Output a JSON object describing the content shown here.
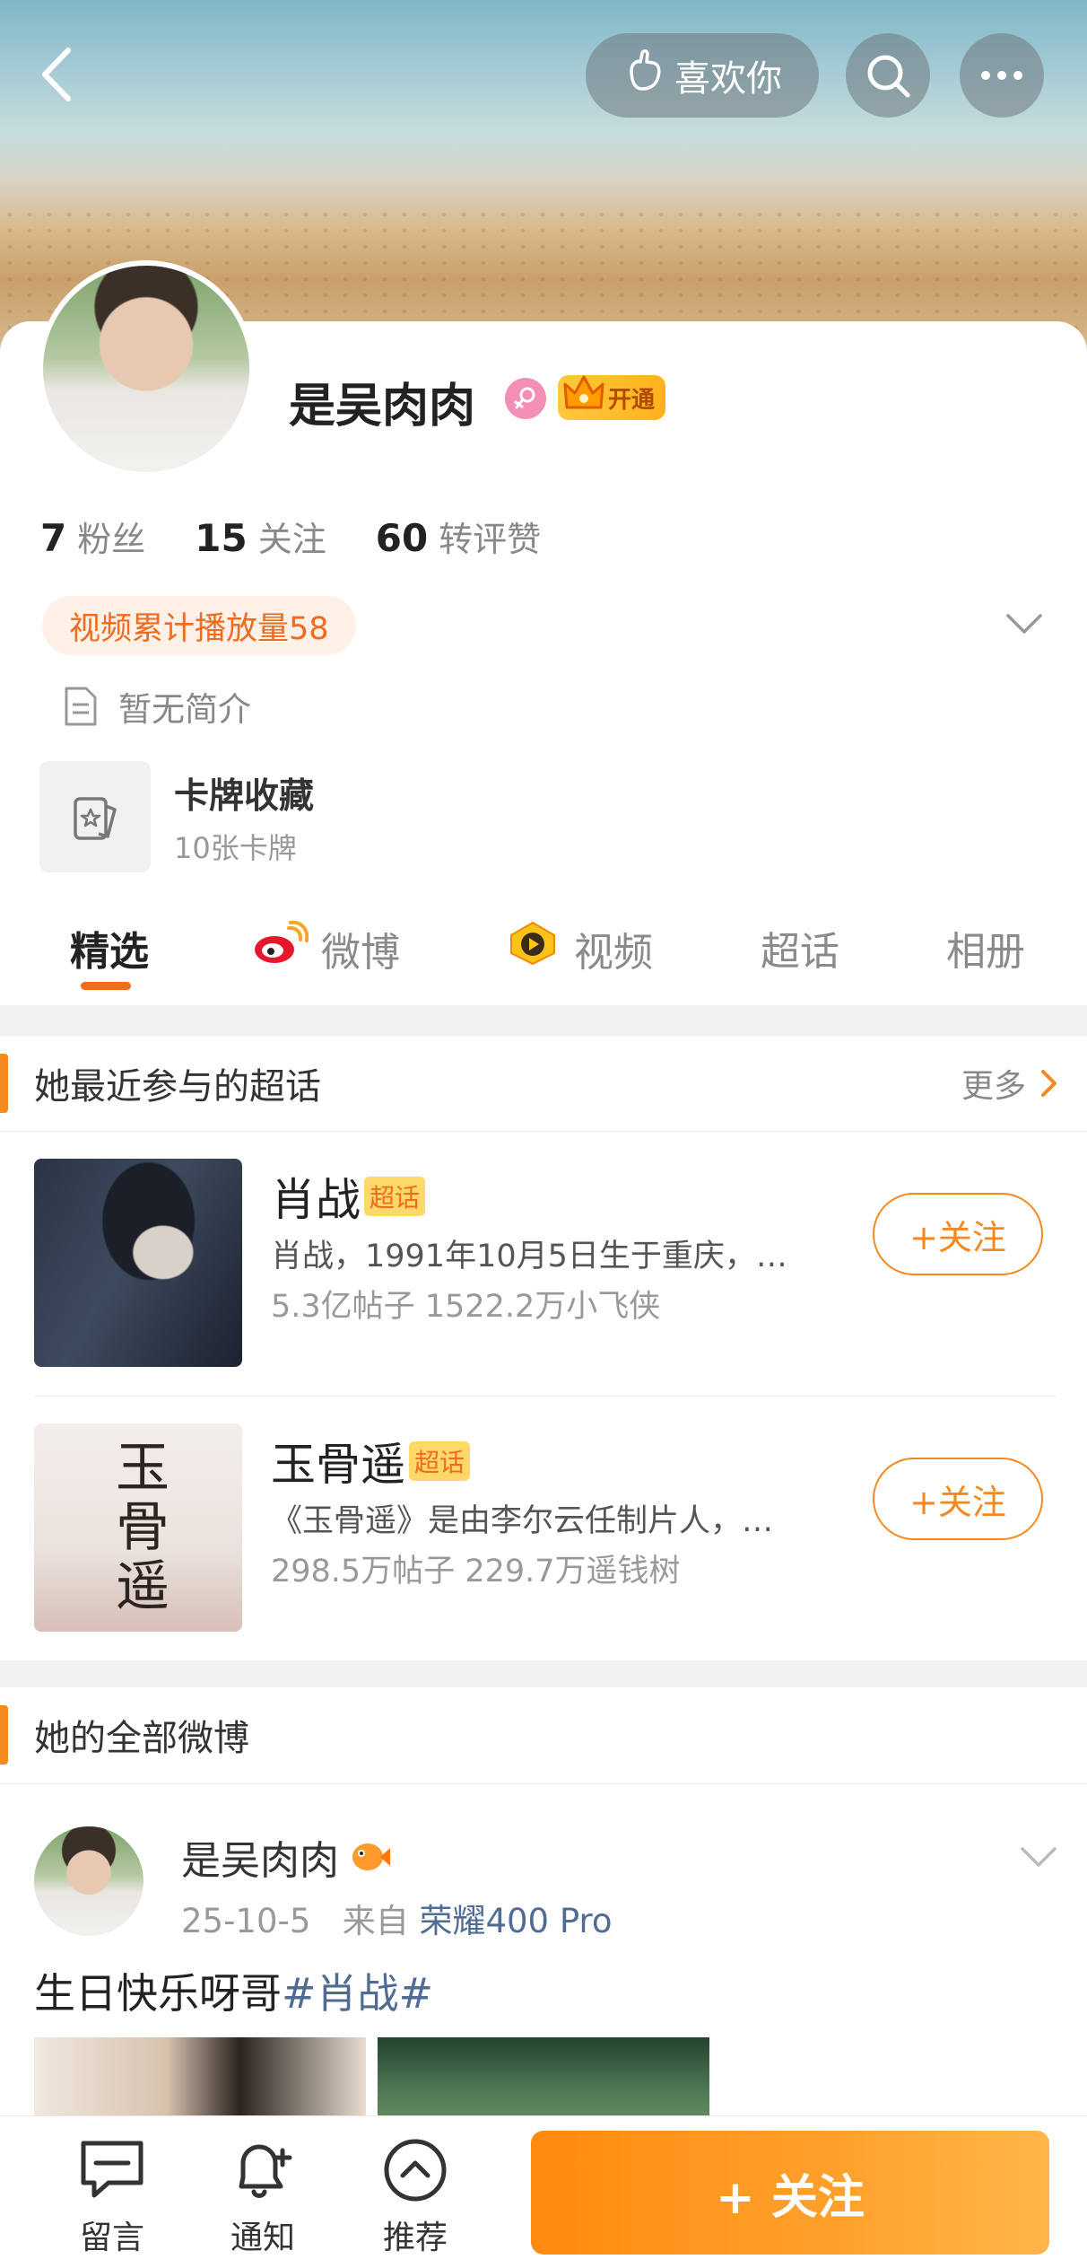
{
  "header": {
    "like_label": "喜欢你"
  },
  "profile": {
    "name": "是吴肉肉",
    "vip_label": "开通",
    "stats": [
      {
        "num": "7",
        "label": "粉丝"
      },
      {
        "num": "15",
        "label": "关注"
      },
      {
        "num": "60",
        "label": "转评赞"
      }
    ],
    "play_tag": "视频累计播放量58",
    "intro": "暂无简介",
    "card_title": "卡牌收藏",
    "card_sub": "10张卡牌"
  },
  "tabs": [
    "精选",
    "微博",
    "视频",
    "超话",
    "相册"
  ],
  "topics_section": {
    "title": "她最近参与的超话",
    "more": "更多",
    "items": [
      {
        "name": "肖战",
        "tag": "超话",
        "desc": "肖战，1991年10月5日生于重庆，…",
        "stats": "5.3亿帖子 1522.2万小飞侠",
        "follow": "+关注"
      },
      {
        "name": "玉骨遥",
        "tag": "超话",
        "desc": "《玉骨遥》是由李尔云任制片人，…",
        "stats": "298.5万帖子 229.7万遥钱树",
        "follow": "+关注",
        "cover_text": "玉骨遥"
      }
    ]
  },
  "posts_section": {
    "title": "她的全部微博"
  },
  "post": {
    "author": "是吴肉肉",
    "date": "25-10-5",
    "from": "来自",
    "device": "荣耀400 Pro",
    "text": "生日快乐呀哥",
    "hashtag": "#肖战#"
  },
  "bottom_bar": {
    "message": "留言",
    "notify": "通知",
    "recommend": "推荐",
    "follow": "+ 关注"
  },
  "colors": {
    "accent": "#f5891f",
    "link": "#506c95",
    "female_badge": "#f38fb7"
  }
}
